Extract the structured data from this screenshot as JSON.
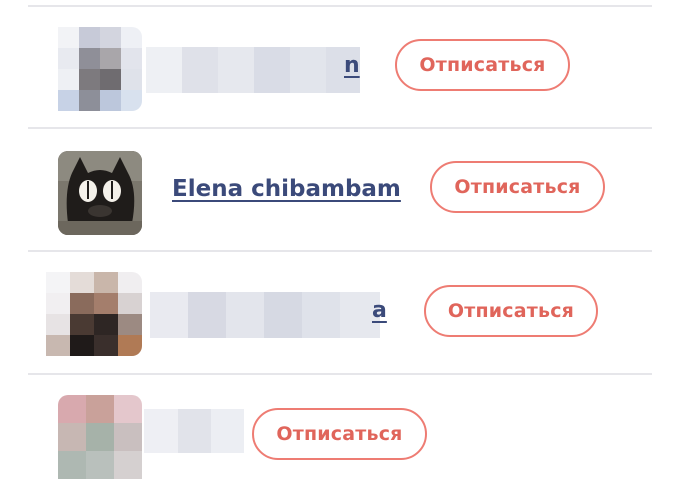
{
  "subscriptions": [
    {
      "name": "",
      "button_label": "Отписаться",
      "name_tail": "n"
    },
    {
      "name": "Elena chibambam",
      "button_label": "Отписаться"
    },
    {
      "name": "",
      "button_label": "Отписаться",
      "name_tail": "a"
    },
    {
      "name": "",
      "button_label": "Отписаться"
    }
  ],
  "colors": {
    "accent": "#e0655b",
    "accent_border": "#ee7c73",
    "link": "#3b4a7a",
    "divider": "#e6e6ea"
  }
}
